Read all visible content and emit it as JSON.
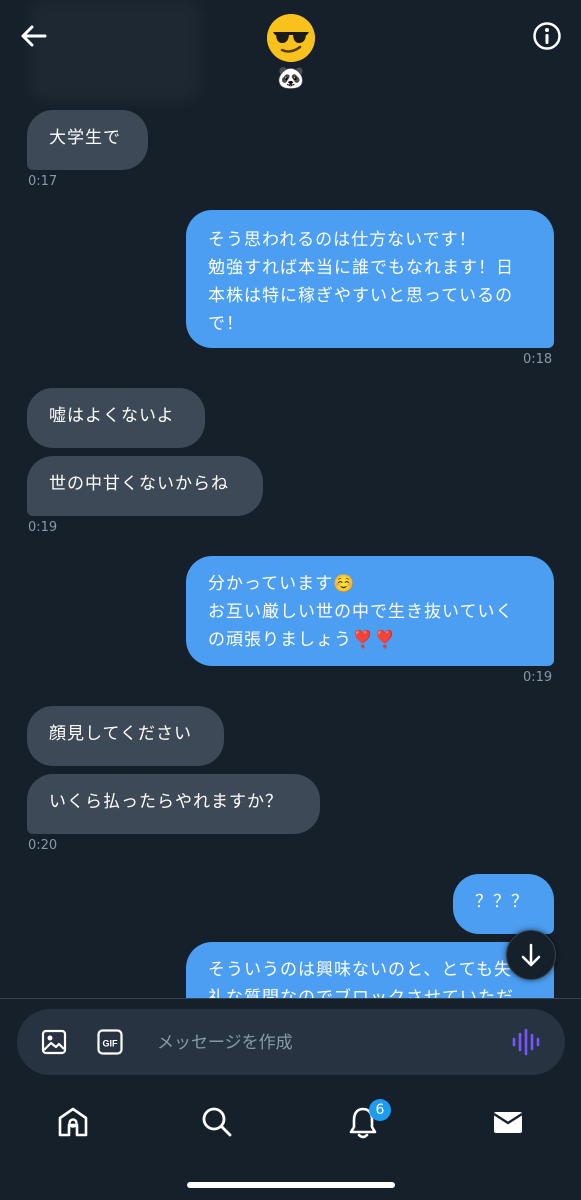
{
  "messages": {
    "m1": {
      "text": "大学生で"
    },
    "t1": "0:17",
    "m2": {
      "text": "そう思われるのは仕方ないです！\n勉強すれば本当に誰でもなれます！日\n本株は特に稼ぎやすいと思っているの\nで！"
    },
    "t2": "0:18",
    "m3": {
      "text": "嘘はよくないよ"
    },
    "m4": {
      "text": "世の中甘くないからね"
    },
    "t3": "0:19",
    "m5": {
      "text": "分かっています☺️\nお互い厳しい世の中で生き抜いていく\nの頑張りましょう❣️❣️"
    },
    "t4": "0:19",
    "m6": {
      "text": "顔見してください"
    },
    "m7": {
      "text": "いくら払ったらやれますか？"
    },
    "t5": "0:20",
    "m8": {
      "text": "？？？"
    },
    "m9": {
      "text": "そういうのは興味ないのと、とても失\n礼な質問なのでブロックさせていただ"
    }
  },
  "composer": {
    "placeholder": "メッセージを作成"
  },
  "tabs": {
    "notifications_badge": "6"
  },
  "header": {
    "sub_emoji": "🐼"
  },
  "icons": {
    "back": "arrow-left-icon",
    "info": "info-icon",
    "image": "image-icon",
    "gif": "gif-icon",
    "voice": "voice-wave-icon",
    "home": "home-icon",
    "search": "search-icon",
    "notifications": "bell-icon",
    "messages": "mail-icon"
  },
  "colors": {
    "background": "#15202b",
    "incoming_bubble": "#3d4956",
    "outgoing_bubble": "#4b9ef2",
    "accent": "#1d9bf0",
    "voice": "#7856ff"
  }
}
